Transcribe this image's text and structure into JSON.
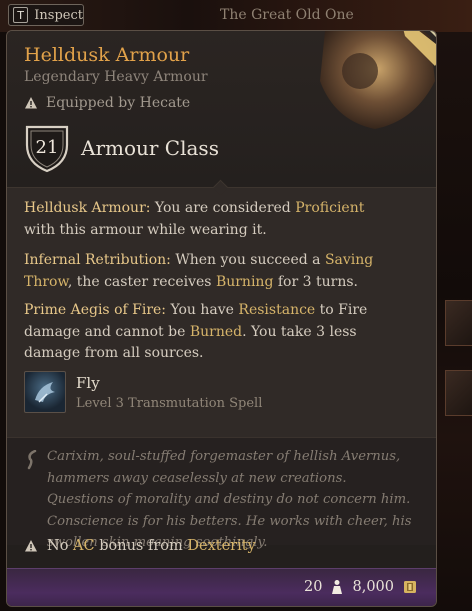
{
  "topbar": {
    "inspect_key": "T",
    "inspect_label": "Inspect",
    "center_title": "The Great Old One"
  },
  "item": {
    "name": "Helldusk Armour",
    "type": "Legendary Heavy Armour",
    "equipped": "Equipped by Hecate",
    "armour_class_value": "21",
    "armour_class_label": "Armour Class"
  },
  "properties": [
    {
      "name": "Helldusk Armour:",
      "parts": [
        " You are considered ",
        "Proficient",
        " with this armour while wearing it."
      ]
    },
    {
      "name": "Infernal Retribution:",
      "parts": [
        " When you succeed a ",
        "Saving Throw",
        ", the caster receives ",
        "Burning",
        " for 3 turns."
      ]
    },
    {
      "name": "Prime Aegis of Fire:",
      "parts": [
        " You have ",
        "Resistance",
        " to Fire damage and cannot be ",
        "Burned",
        ". You take 3 less damage from all sources."
      ]
    }
  ],
  "spell": {
    "name": "Fly",
    "subtitle": "Level 3 Transmutation Spell",
    "icon": "fly-spell-icon"
  },
  "lore": "Carixim, soul-stuffed forgemaster of hellish Avernus, hammers away ceaselessly at new creations. Questions of morality and destiny do not concern him. Conscience is for his betters. He works with cheer, his swollen skin moaning soothingly.",
  "warning": {
    "parts": [
      "No ",
      "AC",
      " bonus from ",
      "Dexterity"
    ]
  },
  "footer": {
    "weight": "20",
    "value": "8,000"
  },
  "colors": {
    "name": "#e2a24a",
    "keyword": "#d6b46a",
    "footer": "#4b2c5e"
  }
}
